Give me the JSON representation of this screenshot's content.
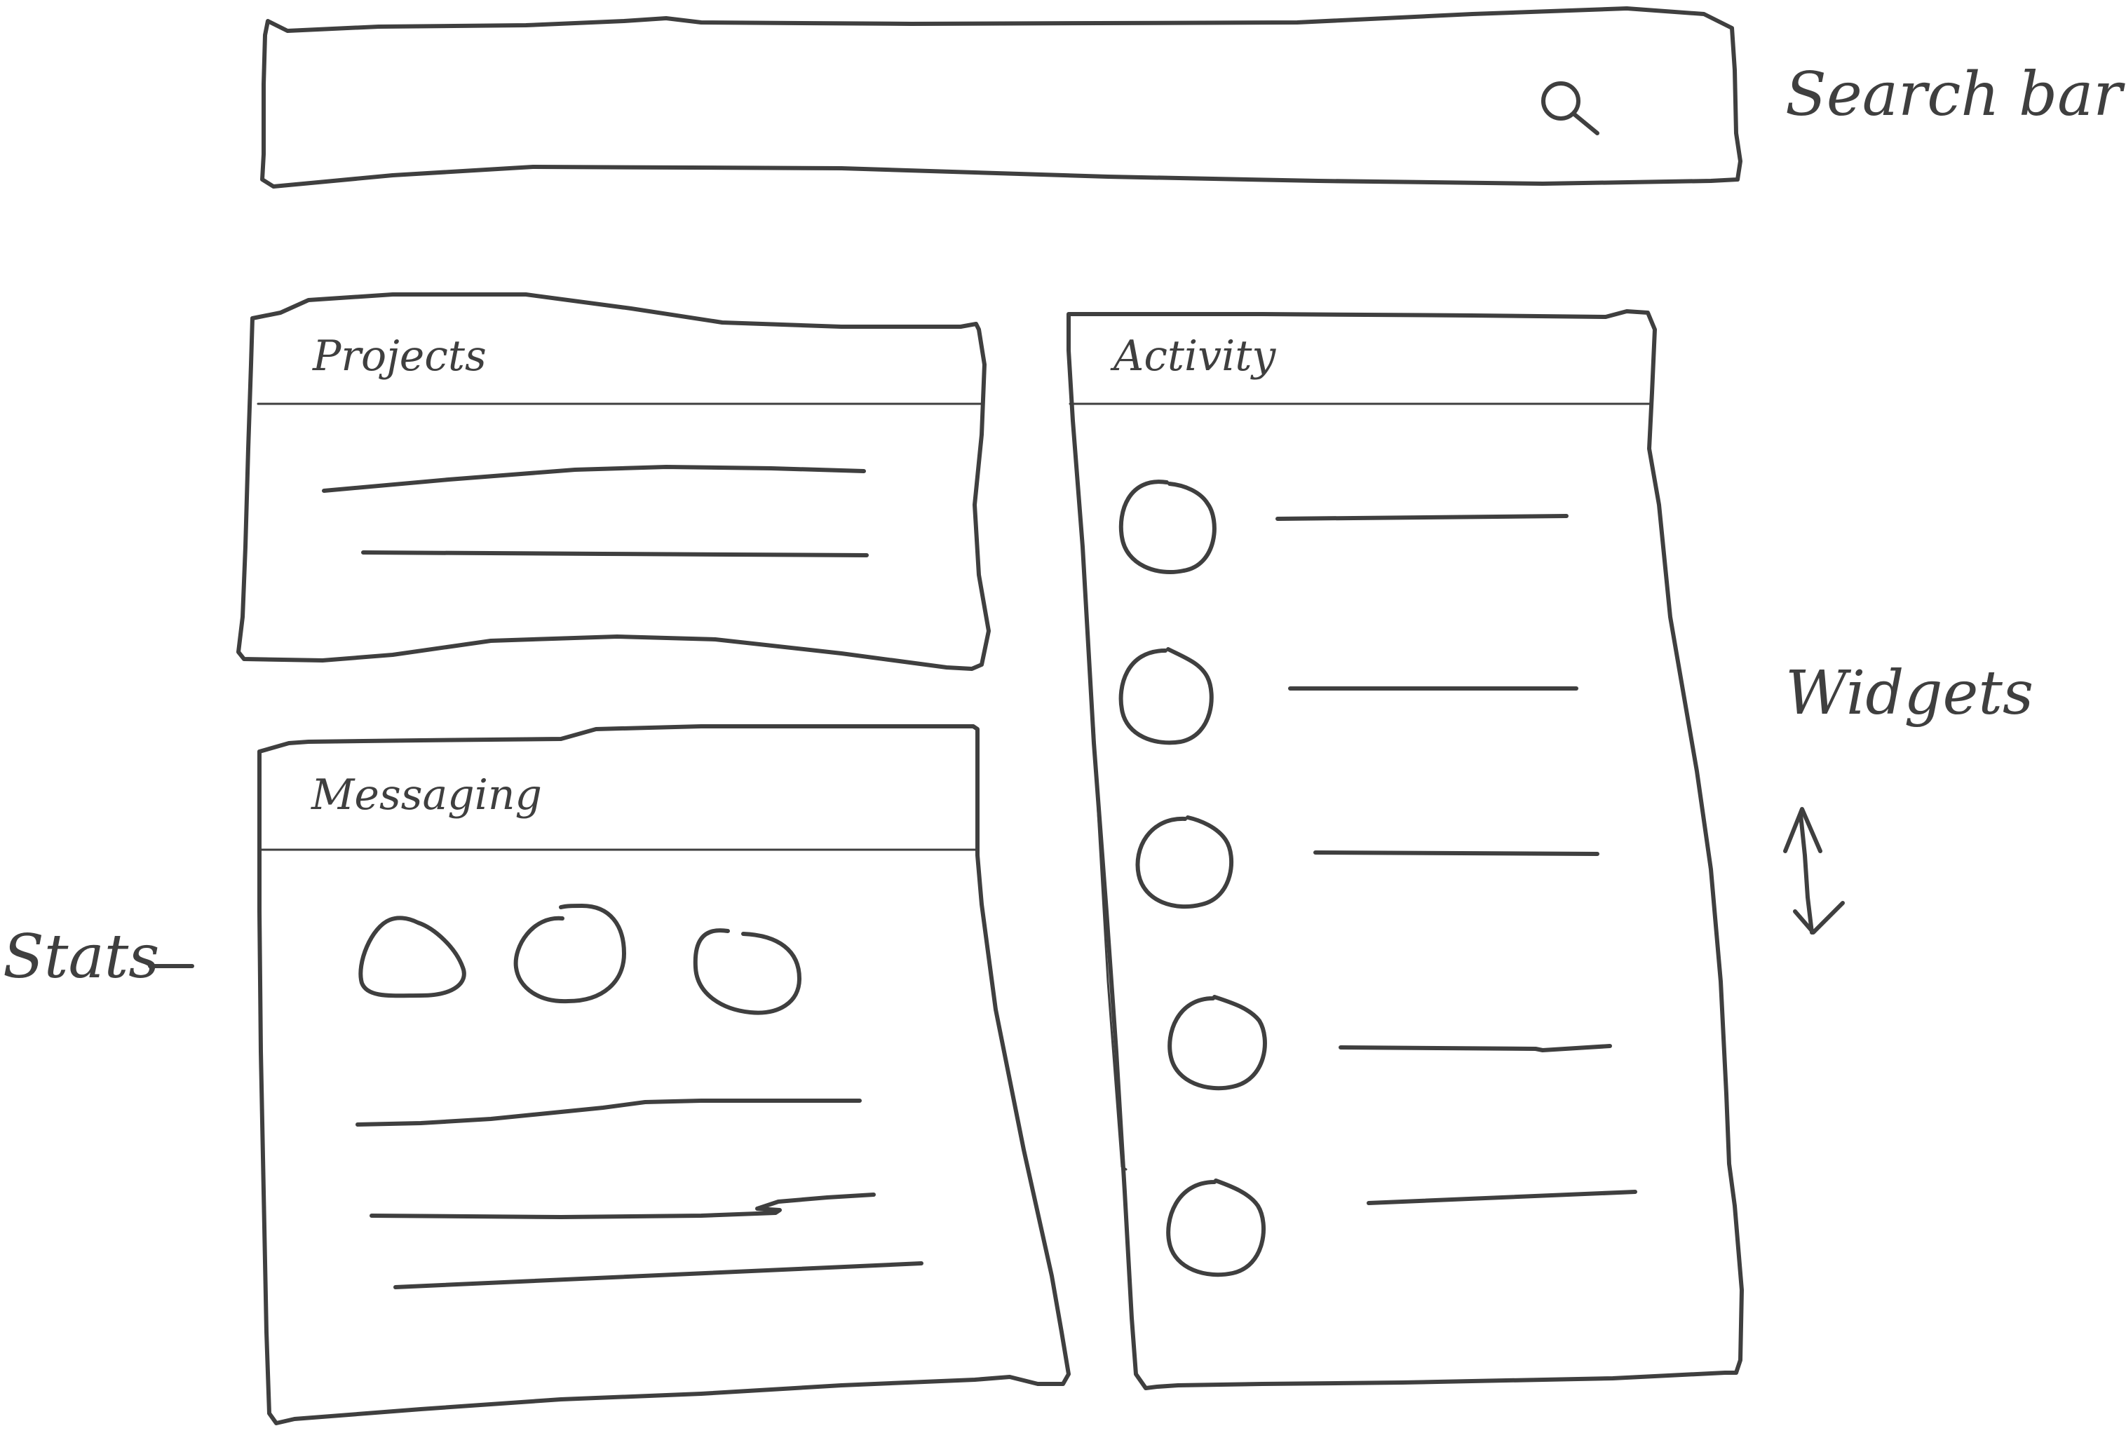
{
  "search_bar": {
    "icon": "search-icon",
    "annotation": "Search bar"
  },
  "widgets": {
    "projects": {
      "title": "Projects"
    },
    "messaging": {
      "title": "Messaging"
    },
    "activity": {
      "title": "Activity"
    }
  },
  "annotations": {
    "stats": "Stats",
    "widgets": "Widgets"
  },
  "colors": {
    "ink": "#3f3f3f",
    "paper": "#ffffff"
  }
}
